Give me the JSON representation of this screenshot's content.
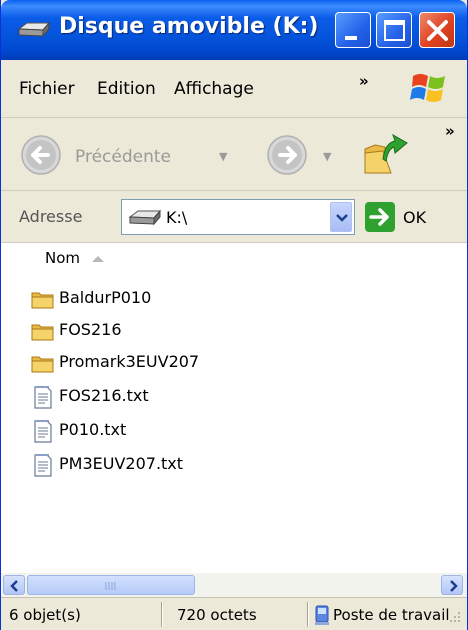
{
  "window": {
    "title": "Disque amovible (K:)"
  },
  "menu": {
    "items": [
      "Fichier",
      "Edition",
      "Affichage"
    ],
    "more": "»"
  },
  "toolbar": {
    "back_label": "Précédente",
    "more": "»",
    "icons": [
      "back-arrow-icon",
      "forward-arrow-icon",
      "folder-up-icon"
    ]
  },
  "address": {
    "label": "Adresse",
    "value": "K:\\",
    "go_label": "OK"
  },
  "list": {
    "column": "Nom",
    "items": [
      {
        "name": "BaldurP010",
        "type": "folder"
      },
      {
        "name": "FOS216",
        "type": "folder"
      },
      {
        "name": "Promark3EUV207",
        "type": "folder"
      },
      {
        "name": "FOS216.txt",
        "type": "text-file"
      },
      {
        "name": "P010.txt",
        "type": "text-file"
      },
      {
        "name": "PM3EUV207.txt",
        "type": "text-file"
      }
    ]
  },
  "status": {
    "count": "6 objet(s)",
    "size": "720 octets",
    "zone": "Poste de travail"
  },
  "colors": {
    "titlebar": "#0554dc",
    "chrome": "#ece9d8",
    "folder": "#f5d36b",
    "go_arrow": "#2ea12e",
    "close": "#df4322"
  }
}
